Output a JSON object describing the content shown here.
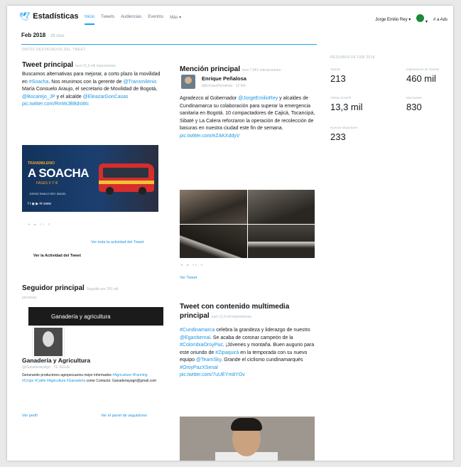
{
  "app": {
    "name": "Estadísticas",
    "bird_icon": "twitter-bird-icon"
  },
  "nav": {
    "tabs": [
      "Inicio",
      "Tweets",
      "Audiencias",
      "Eventos",
      "Más"
    ],
    "user": "Jorge Emilio Rey",
    "ads": "# a Ads"
  },
  "period": {
    "label": "Feb 2018",
    "days": "· 28 días"
  },
  "section_label": "Datos destacados del Tweet",
  "top_tweet": {
    "title": "Tweet principal",
    "sub": "tuvo 31,5 mil impresiones",
    "text_parts": [
      "Buscamos alternativas para mejorar, a corto plazo la movilidad en ",
      "#Soacha",
      ". Nos reunimos con la gerente de ",
      "@Transmilenio",
      " María Consuelo Araujo, el secretario de Movilidad de Bogotá, ",
      "@Bocarejo_JP",
      " y el alcalde ",
      "@EleazarGonCasas",
      "pic.twitter.com/RmWJBBdsWc"
    ],
    "image": {
      "line1": "TRANSMILENIO",
      "line2": "A SOACHA",
      "line3": "FASES II Y III",
      "line4": "JORGE EMILIO REY ÁNGEL",
      "icons": "f  t  ◉  ▶  ✉  www"
    },
    "engagements": "♥ ⇄ 21 ⚲",
    "link_activity": "Ver toda la actividad del Tweet",
    "link_activity_bold": "Ver la Actividad del Tweet"
  },
  "top_mention": {
    "title": "Mención principal",
    "sub": "tuvo 7.661 interacciones",
    "author": "Enrique Peñalosa",
    "handle": "@EnriquePenalosa · 12 feb.",
    "text_parts": [
      "Agradezco al Gobernador ",
      "@JorgeEmilioRey",
      " y alcaldes de Cundinamarca su colaboración para superar la emergencia sanitaria en Bogotá. 10 compactadores de Cajicá, Tocancipá, Sibaté y La Calera reforzaron la operación de recolección de basuras en nuestra ciudad este fin de semana. ",
      "pic.twitter.com/eZAKXddyV"
    ],
    "engagements": "♥ ⇄ 96 ⚲",
    "link": "Ver Tweet"
  },
  "summary": {
    "label": "Resumen de Feb 2018",
    "stats": [
      {
        "label": "Tweets",
        "value": "213"
      },
      {
        "label": "Impresiones de Tweets",
        "value": "460 mil"
      },
      {
        "label": "Visitas al perfil",
        "value": "13,3 mil"
      },
      {
        "label": "Menciones",
        "value": "830"
      },
      {
        "label": "Nuevos seguidores",
        "value": "233"
      }
    ]
  },
  "top_follower": {
    "title": "Seguidor principal",
    "sub": "Seguido por 291 mil",
    "sub2": "personas",
    "banner_text": "Ganadería y agricultura",
    "name": "Ganadería y Agricultura",
    "handle": "@GanaderiayAgri · TE SIGUE",
    "bio_parts": [
      "Generando productores agropecuarios mejor informados ",
      "#Agriculture #Farming #Crops #Cattle #Agricultura #Ganadería",
      " come Contacto: Ganaderiayagri@gmail.com"
    ],
    "link_profile": "Ver perfil",
    "link_followers": "Ver el panel de seguidores"
  },
  "top_media": {
    "title_line1": "Tweet con contenido multimedia",
    "title_line2": "principal",
    "sub": "tuvo 11,5 mil impresiones",
    "text_parts": [
      "#Cundinamarca",
      " celebra la grandeza y liderazgo de nuestro ",
      "@Egan­bernal",
      ". Se acaba de coronar campeón de la ",
      "#ColombiaOroyPaz",
      ". ¡Jóvenes y montaña. Buen augurio para este oriundo de ",
      "#Zipaquirá",
      " en la temporada con su nuevo equipo ",
      "@TeamSky",
      ". Grande el ciclismo cundinamarqués ",
      "#OroyPazXSenal",
      "pic.twitter.com/7uUEYm8YOv"
    ]
  },
  "colors": {
    "accent": "#1da1f2",
    "link": "#1b95e0",
    "muted": "#aab8c2"
  }
}
